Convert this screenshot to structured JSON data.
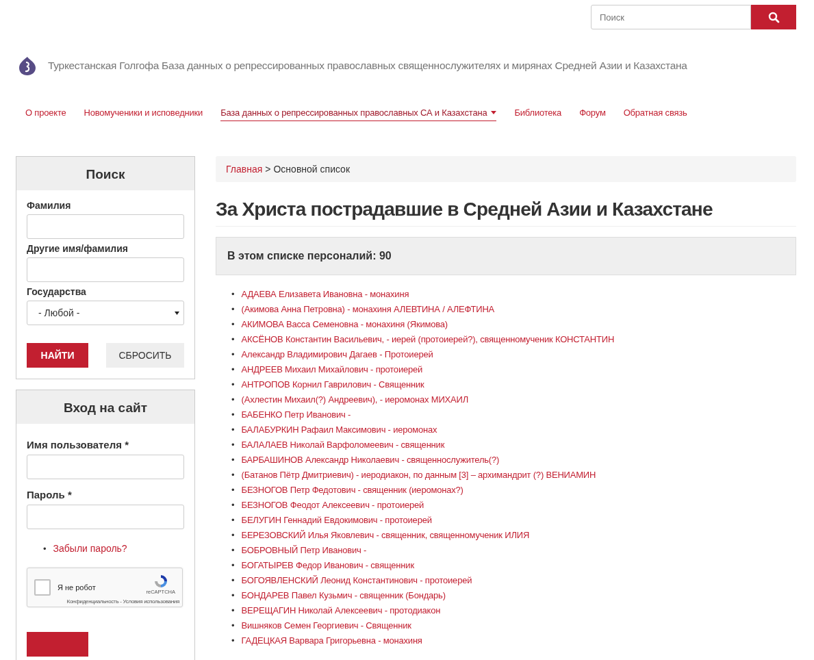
{
  "search": {
    "placeholder": "Поиск"
  },
  "site": {
    "title": "Туркестанская Голгофа База данных о репрессированных православных священнослужителях и мирянах Средней Азии и Казахстана"
  },
  "nav": [
    {
      "label": "О проекте",
      "selected": false,
      "dropdown": false
    },
    {
      "label": "Новомученики и исповедники",
      "selected": false,
      "dropdown": false
    },
    {
      "label": "База данных о репрессированных православных СА и Казахстана",
      "selected": true,
      "dropdown": true
    },
    {
      "label": "Библиотека",
      "selected": false,
      "dropdown": false
    },
    {
      "label": "Форум",
      "selected": false,
      "dropdown": false
    },
    {
      "label": "Обратная связь",
      "selected": false,
      "dropdown": false
    }
  ],
  "filter": {
    "title": "Поиск",
    "fields": [
      {
        "label": "Фамилия",
        "kind": "text"
      },
      {
        "label": "Другие имя/фамилия",
        "kind": "text"
      },
      {
        "label": "Государства",
        "kind": "select",
        "value": "- Любой -"
      }
    ],
    "submit": "НАЙТИ",
    "reset": "СБРОСИТЬ"
  },
  "login": {
    "title": "Вход на сайт",
    "fields": [
      {
        "label": "Имя пользователя *"
      },
      {
        "label": "Пароль *"
      }
    ],
    "forgot": {
      "marker": "•",
      "text": "Забыли пароль?"
    },
    "captcha": {
      "label": "Я не робот",
      "checked": false,
      "brand": "reCAPTCHA",
      "links": "Конфиденциальность - Условия использования"
    }
  },
  "breadcrumb": {
    "home": "Главная",
    "separator": ">",
    "current": "Основной список"
  },
  "heading": "За Христа пострадавшие в Средней Азии и Казахстане",
  "count": "В этом списке персоналий: 90",
  "people": [
    {
      "marker": "•",
      "text": "АДАЕВА Елизавета Ивановна - монахиня"
    },
    {
      "marker": "•",
      "text": "(Акимова Анна Петровна) - монахиня АЛЕВТИНА / АЛЕФТИНА"
    },
    {
      "marker": "•",
      "text": "АКИМОВА Васса Семеновна - монахиня (Якимова)"
    },
    {
      "marker": "•",
      "text": "АКСЁНОВ Константин Васильевич, - иерей (протоиерей?), священномученик КОНСТАНТИН"
    },
    {
      "marker": "•",
      "text": "Александр Владимирович Дагаев - Протоиерей"
    },
    {
      "marker": "•",
      "text": "АНДРЕЕВ Михаил Михайлович - протоиерей"
    },
    {
      "marker": "•",
      "text": "АНТРОПОВ Корнил Гаврилович - Священник"
    },
    {
      "marker": "•",
      "text": "(Ахлестин Михаил(?) Андреевич), - иеромонах МИХАИЛ"
    },
    {
      "marker": "•",
      "text": "БАБЕНКО Петр Иванович -"
    },
    {
      "marker": "•",
      "text": "БАЛАБУРКИН Рафаил Максимович - иеромонах"
    },
    {
      "marker": "•",
      "text": "БАЛАЛАЕВ Николай Варфоломеевич - священник"
    },
    {
      "marker": "•",
      "text": "БАРБАШИНОВ Александр Николаевич - священнослужитель(?)"
    },
    {
      "marker": "•",
      "text": "(Батанов Пётр Дмитриевич) - иеродиакон, по данным [3] – архимандрит (?) ВЕНИАМИН"
    },
    {
      "marker": "•",
      "text": "БЕЗНОГОВ Петр Федотович - священник (иеромонах?)"
    },
    {
      "marker": "•",
      "text": "БЕЗНОГОВ Феодот Алексеевич - протоиерей"
    },
    {
      "marker": "•",
      "text": "БЕЛУГИН Геннадий Евдокимович - протоиерей"
    },
    {
      "marker": "•",
      "text": "БЕРЕЗОВСКИЙ Илья Яковлевич - священник, священномученик ИЛИЯ"
    },
    {
      "marker": "•",
      "text": "БОБРОВНЫЙ Петр Иванович -"
    },
    {
      "marker": "•",
      "text": "БОГАТЫРЕВ Федор Иванович - священник"
    },
    {
      "marker": "•",
      "text": "БОГОЯВЛЕНСКИЙ Леонид Константинович - протоиерей"
    },
    {
      "marker": "•",
      "text": "БОНДАРЕВ Павел Кузьмич - священник (Бондарь)"
    },
    {
      "marker": "•",
      "text": "ВЕРЕЩАГИН Николай Алексеевич - протодиакон"
    },
    {
      "marker": "•",
      "text": "Вишняков Семен Георгиевич - Священник"
    },
    {
      "marker": "•",
      "text": "ГАДЕЦКАЯ Варвара Григорьевна - монахиня"
    }
  ]
}
